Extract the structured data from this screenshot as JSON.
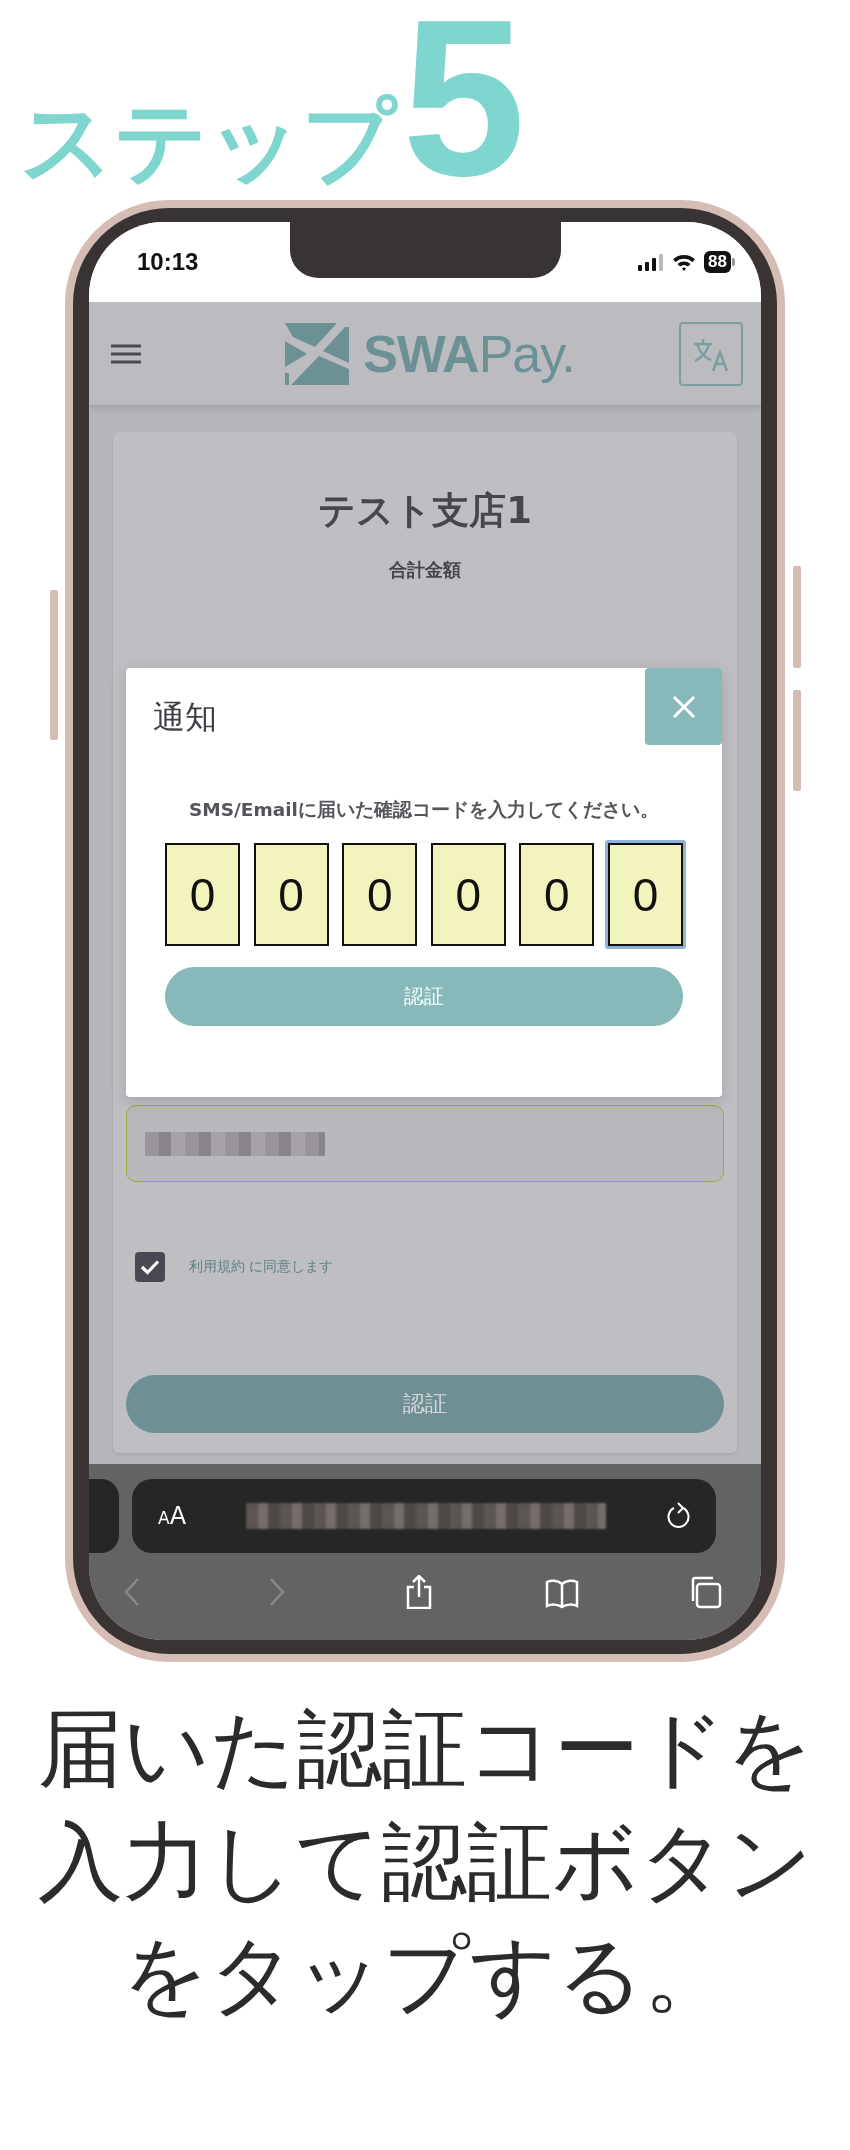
{
  "step_heading": {
    "label": "ステップ",
    "number": "5"
  },
  "status_bar": {
    "time": "10:13",
    "battery": "88"
  },
  "app_header": {
    "logo": "**SWA**Pay."
  },
  "store_card": {
    "store_name": "テスト支店1",
    "total_label": "合計金額",
    "terms": {
      "label": "利用規約 に同意します",
      "checked": true
    },
    "submit_button": "認証"
  },
  "dialog": {
    "title": "通知",
    "message": "SMS/Emailに届いた確認コードを入力してください。",
    "code_digits": [
      {
        "value": "0",
        "selected": false
      },
      {
        "value": "0",
        "selected": false
      },
      {
        "value": "0",
        "selected": false
      },
      {
        "value": "0",
        "selected": false
      },
      {
        "value": "0",
        "selected": false
      },
      {
        "value": "0",
        "selected": true
      }
    ],
    "submit_button": "認証"
  },
  "browser_bar": {
    "text_size_button": "AA"
  },
  "caption": "届いた認証コードを入力して認証ボタンをタップする。"
}
